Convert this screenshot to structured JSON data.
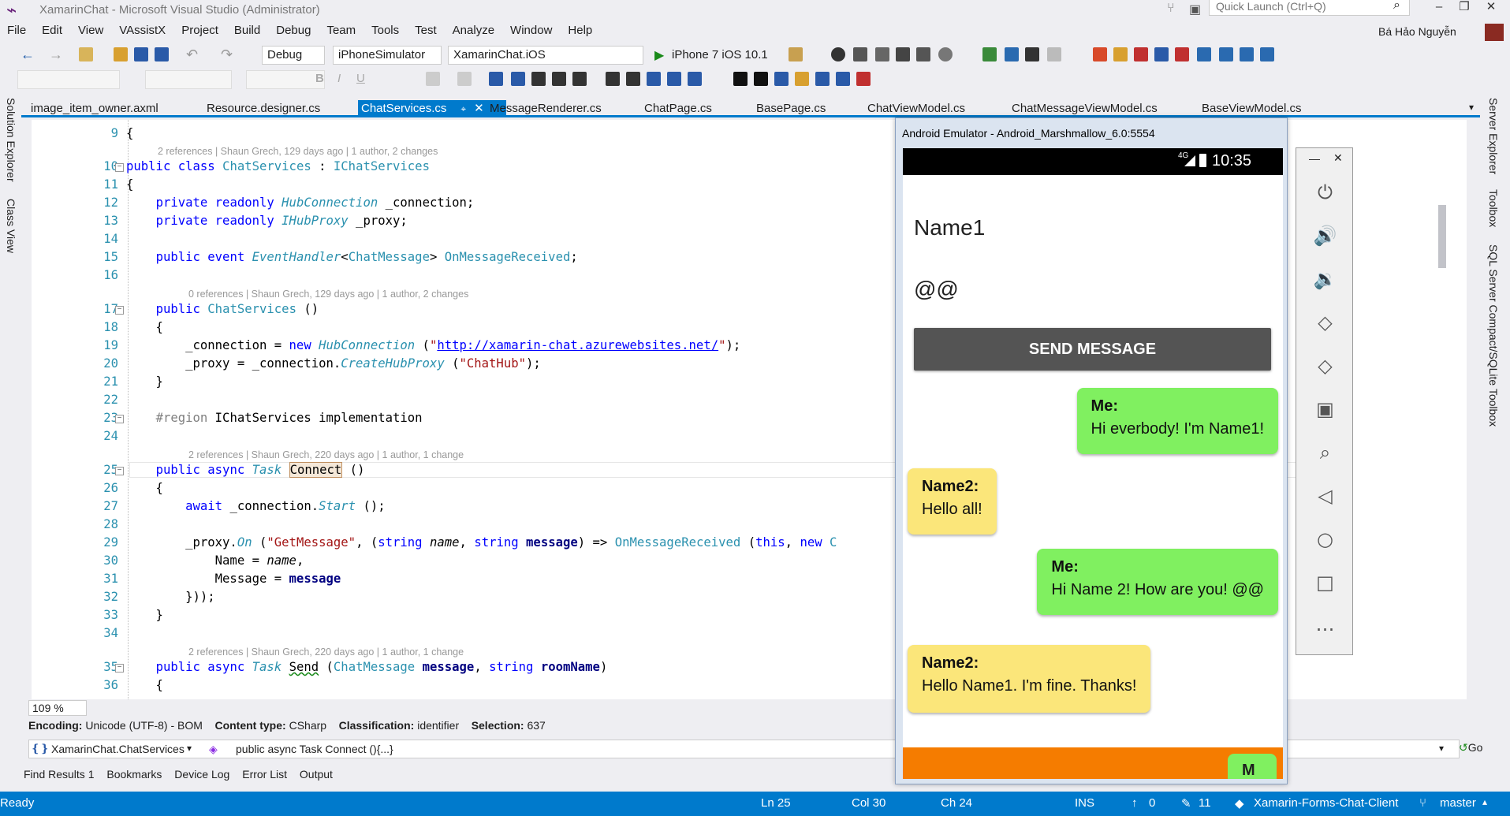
{
  "window": {
    "title": "XamarinChat - Microsoft Visual Studio (Administrator)",
    "quick_launch_placeholder": "Quick Launch (Ctrl+Q)",
    "user": "Bá Hảo Nguyễn"
  },
  "menu": [
    "File",
    "Edit",
    "View",
    "VAssistX",
    "Project",
    "Build",
    "Debug",
    "Team",
    "Tools",
    "Test",
    "Analyze",
    "Window",
    "Help"
  ],
  "toolbar": {
    "config": "Debug",
    "platform": "iPhoneSimulator",
    "project": "XamarinChat.iOS",
    "run_target": "iPhone 7 iOS 10.1"
  },
  "tabs": [
    "image_item_owner.axml",
    "Resource.designer.cs",
    "ChatServices.cs",
    "MessageRenderer.cs",
    "ChatPage.cs",
    "BasePage.cs",
    "ChatViewModel.cs",
    "ChatMessageViewModel.cs",
    "BaseViewModel.cs"
  ],
  "active_tab": "ChatServices.cs",
  "side_panels_left": [
    "Solution Explorer",
    "Class View"
  ],
  "side_panels_right": [
    "Server Explorer",
    "Toolbox",
    "SQL Server Compact/SQLite Toolbox"
  ],
  "code": {
    "lens": [
      "2 references | Shaun Grech, 129 days ago | 1 author, 2 changes",
      "0 references | Shaun Grech, 129 days ago | 1 author, 2 changes",
      "2 references | Shaun Grech, 220 days ago | 1 author, 1 change",
      "2 references | Shaun Grech, 220 days ago | 1 author, 1 change"
    ],
    "line_numbers": [
      "9",
      "10",
      "11",
      "12",
      "13",
      "14",
      "15",
      "16",
      "17",
      "18",
      "19",
      "20",
      "21",
      "22",
      "23",
      "24",
      "25",
      "26",
      "27",
      "28",
      "29",
      "30",
      "31",
      "32",
      "33",
      "34",
      "35",
      "36"
    ],
    "url": "http://xamarin-chat.azurewebsites.net/"
  },
  "editor_status": {
    "zoom": "109 %",
    "encoding_label": "Encoding:",
    "encoding": "Unicode (UTF-8) - BOM",
    "content_type_label": "Content type:",
    "content_type": "CSharp",
    "classification_label": "Classification:",
    "classification": "identifier",
    "selection_label": "Selection:",
    "selection": "637"
  },
  "navbar": {
    "scope": "XamarinChat.ChatServices.C",
    "member": "public async Task Connect (){...}",
    "go": "Go"
  },
  "panel_tabs": [
    "Find Results 1",
    "Bookmarks",
    "Device Log",
    "Error List",
    "Output"
  ],
  "statusbar": {
    "state": "Ready",
    "line": "Ln 25",
    "col": "Col 30",
    "ch": "Ch 24",
    "mode": "INS",
    "up": "0",
    "changes": "11",
    "repo": "Xamarin-Forms-Chat-Client",
    "branch": "master"
  },
  "emulator": {
    "title": "Android Emulator - Android_Marshmallow_6.0:5554",
    "time": "10:35",
    "network": "4G",
    "name_field": "Name1",
    "message_field": "@@",
    "send_button": "SEND MESSAGE",
    "messages": [
      {
        "sender": "Me:",
        "text": "Hi everbody! I'm Name1!",
        "mine": true
      },
      {
        "sender": "Name2:",
        "text": "Hello all!",
        "mine": false
      },
      {
        "sender": "Me:",
        "text": "Hi Name 2! How are you! @@",
        "mine": true
      },
      {
        "sender": "Name2:",
        "text": "Hello Name1. I'm fine. Thanks!",
        "mine": false
      }
    ],
    "partial_message": "M"
  },
  "colors": {
    "accent": "#007acc",
    "my_bubble": "#80f060",
    "their_bubble": "#fbe67a",
    "bottom_bar": "#f57c00"
  }
}
